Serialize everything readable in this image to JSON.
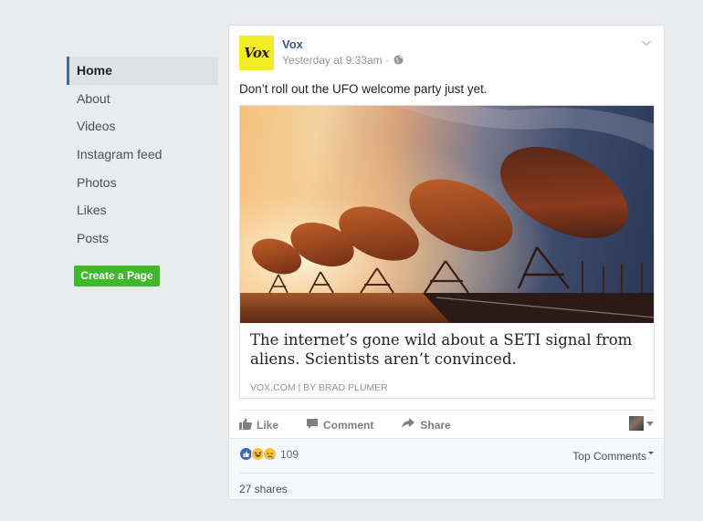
{
  "sidebar": {
    "items": [
      {
        "label": "Home",
        "active": true
      },
      {
        "label": "About"
      },
      {
        "label": "Videos"
      },
      {
        "label": "Instagram feed"
      },
      {
        "label": "Photos"
      },
      {
        "label": "Likes"
      },
      {
        "label": "Posts"
      }
    ],
    "create_page_label": "Create a Page"
  },
  "post": {
    "page_logo_text": "Vox",
    "page_name": "Vox",
    "timestamp": "Yesterday at 9:33am",
    "separator": " · ",
    "privacy_icon": "globe-icon",
    "text": "Don’t roll out the UFO welcome party just yet.",
    "link": {
      "image_alt": "Row of radio telescope dishes at sunset under the Milky Way",
      "title": "The internet’s gone wild about a SETI signal from aliens. Scientists aren’t convinced.",
      "source": "VOX.COM | BY BRAD PLUMER"
    },
    "actions": [
      {
        "label": "Like",
        "icon": "thumbs-up-icon"
      },
      {
        "label": "Comment",
        "icon": "comment-icon"
      },
      {
        "label": "Share",
        "icon": "share-arrow-icon"
      }
    ],
    "reactions": {
      "types": [
        "like",
        "haha",
        "sad"
      ],
      "count": "109"
    },
    "sort_label": "Top Comments",
    "shares": "27 shares"
  },
  "colors": {
    "background": "#e9ebee",
    "link_blue": "#365899",
    "accent_blue": "#4267b2",
    "create_green": "#42b72a",
    "vox_yellow": "#f4ec27"
  }
}
